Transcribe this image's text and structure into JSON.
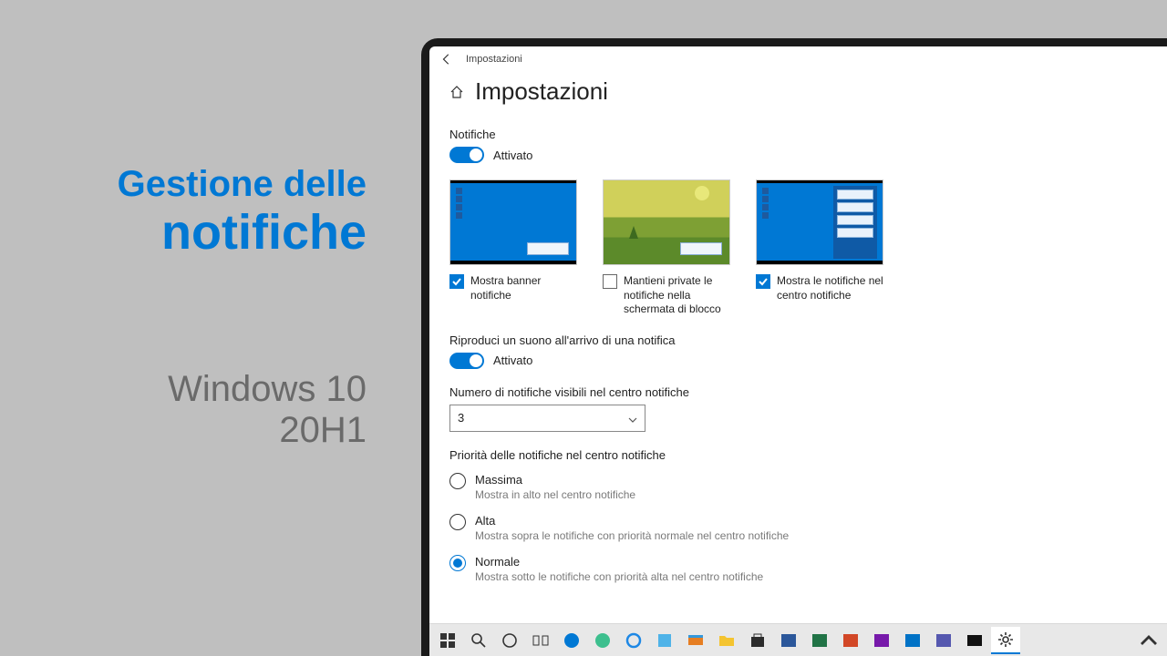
{
  "promo": {
    "line1": "Gestione delle",
    "line2": "notifiche",
    "sub1": "Windows 10",
    "sub2": "20H1"
  },
  "window": {
    "breadcrumb": "Impostazioni",
    "page_title": "Impostazioni"
  },
  "notifications": {
    "label": "Notifiche",
    "toggle_state": "Attivato",
    "options": [
      {
        "label": "Mostra banner notifiche",
        "checked": true
      },
      {
        "label": "Mantieni private le notifiche nella schermata di blocco",
        "checked": false
      },
      {
        "label": "Mostra le notifiche nel centro notifiche",
        "checked": true
      }
    ],
    "sound": {
      "label": "Riproduci un suono all'arrivo di una notifica",
      "state": "Attivato"
    },
    "visible_count": {
      "label": "Numero di notifiche visibili nel centro notifiche",
      "value": "3"
    },
    "priority": {
      "label": "Priorità delle notifiche nel centro notifiche",
      "items": [
        {
          "label": "Massima",
          "desc": "Mostra in alto nel centro notifiche",
          "selected": false
        },
        {
          "label": "Alta",
          "desc": "Mostra sopra le notifiche con priorità normale nel centro notifiche",
          "selected": false
        },
        {
          "label": "Normale",
          "desc": "Mostra sotto le notifiche con priorità alta nel centro notifiche",
          "selected": true
        }
      ]
    }
  },
  "taskbar": {
    "items": [
      "start",
      "search",
      "cortana",
      "task-view",
      "edge",
      "edge-dev",
      "ie",
      "dev",
      "movies",
      "store",
      "app",
      "word",
      "excel",
      "powerpoint",
      "onenote",
      "outlook",
      "teams",
      "terminal",
      "settings"
    ]
  }
}
